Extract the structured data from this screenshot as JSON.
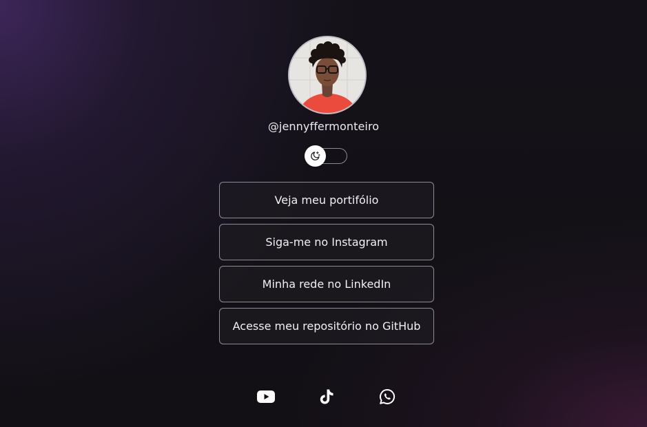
{
  "profile": {
    "photo_alt": "profile-photo",
    "username": "@jennyffermonteiro"
  },
  "theme_toggle": {
    "icon": "moon-stars-icon",
    "state": "dark"
  },
  "links": [
    {
      "label": "Veja meu portifólio"
    },
    {
      "label": "Siga-me no Instagram"
    },
    {
      "label": "Minha rede no LinkedIn"
    },
    {
      "label": "Acesse meu repositório no GitHub"
    }
  ],
  "socials": [
    {
      "icon": "youtube-icon"
    },
    {
      "icon": "tiktok-icon"
    },
    {
      "icon": "whatsapp-icon"
    }
  ],
  "colors": {
    "background": "#131117",
    "accent_purple": "#4a2c6e",
    "accent_magenta": "#461c3e",
    "border": "#8e8c96",
    "text": "#f1f1f3"
  }
}
